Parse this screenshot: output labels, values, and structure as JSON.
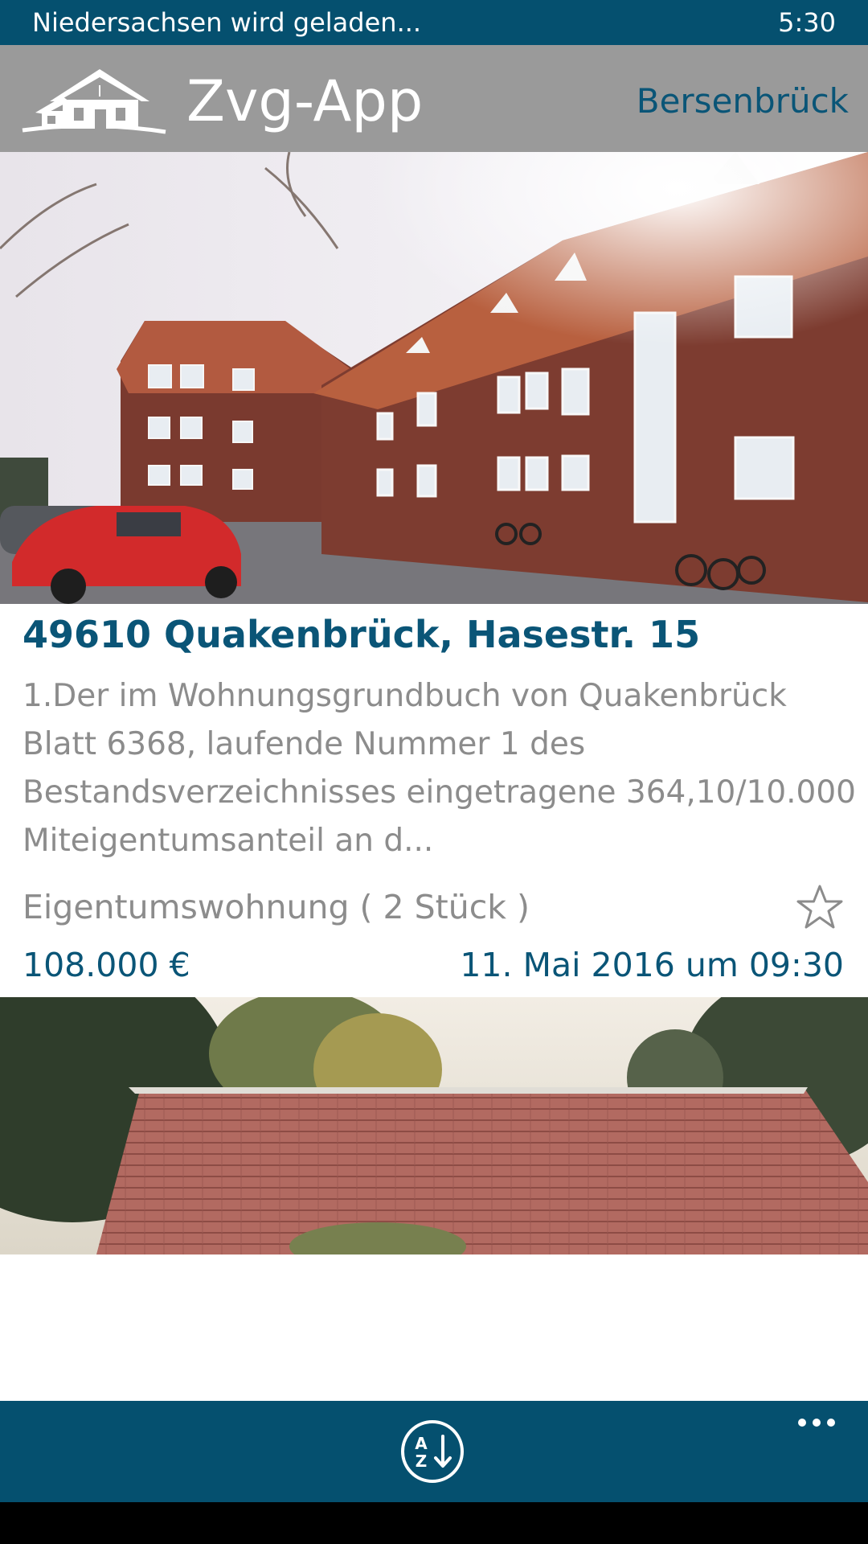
{
  "status_bar": {
    "message": "Niedersachsen wird geladen...",
    "time": "5:30"
  },
  "header": {
    "app_title": "Zvg-App",
    "location": "Bersenbrück",
    "logo_icon": "house-logo-icon"
  },
  "listings": [
    {
      "title": "49610 Quakenbrück, Hasestr. 15",
      "description_lines": [
        "1.Der im Wohnungsgrundbuch von Quakenbrück",
        "Blatt 6368, laufende Nummer 1 des",
        "Bestandsverzeichnisses eingetragene 364,10/10.000",
        "Miteigentumsanteil an d..."
      ],
      "type": "Eigentumswohnung ( 2 Stück )",
      "price": "108.000 €",
      "date": "11. Mai 2016 um 09:30",
      "favorite_icon": "star-outline-icon"
    }
  ],
  "app_bar": {
    "sort_icon": "sort-az-icon",
    "more_icon": "more-dots-icon"
  },
  "colors": {
    "accent": "#05506f",
    "title_blue": "#0a5577",
    "header_gray": "#9a9a9a",
    "text_gray": "#8c8c8c"
  }
}
